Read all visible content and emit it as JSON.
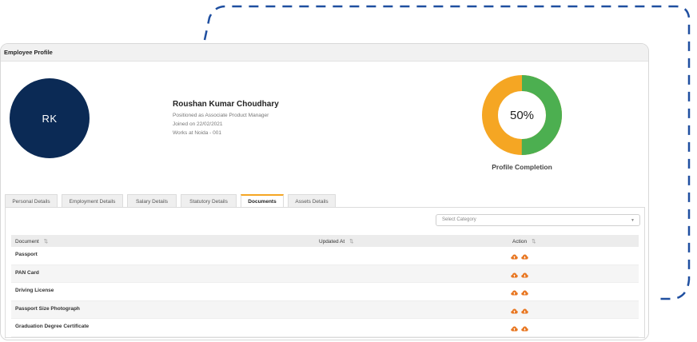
{
  "header": {
    "title": "Employee Profile"
  },
  "profile": {
    "initials": "RK",
    "name": "Roushan Kumar Choudhary",
    "position": "Positioned as Associate Product Manager",
    "joined": "Joined on 22/02/2021",
    "location": "Works at Noida - 001",
    "avatar_color": "#0b2a55"
  },
  "completion": {
    "percent_label": "50%",
    "percent": 50,
    "label": "Profile Completion",
    "complete_color": "#4caf50",
    "remaining_color": "#f5a623"
  },
  "tabs": [
    {
      "label": "Personal Details",
      "active": false
    },
    {
      "label": "Employment Details",
      "active": false
    },
    {
      "label": "Salary Details",
      "active": false
    },
    {
      "label": "Statutory Details",
      "active": false
    },
    {
      "label": "Documents",
      "active": true
    },
    {
      "label": "Assets Details",
      "active": false
    }
  ],
  "filter": {
    "placeholder": "Select Category"
  },
  "table": {
    "columns": [
      "Document",
      "Updated At",
      "Action"
    ],
    "rows": [
      {
        "document": "Passport",
        "updated_at": ""
      },
      {
        "document": "PAN Card",
        "updated_at": ""
      },
      {
        "document": "Driving License",
        "updated_at": ""
      },
      {
        "document": "Passport Size Photograph",
        "updated_at": ""
      },
      {
        "document": "Graduation Degree Certificate",
        "updated_at": ""
      }
    ],
    "action_icons": [
      "cloud-upload-icon",
      "cloud-download-icon"
    ],
    "action_color": "#e87722"
  }
}
